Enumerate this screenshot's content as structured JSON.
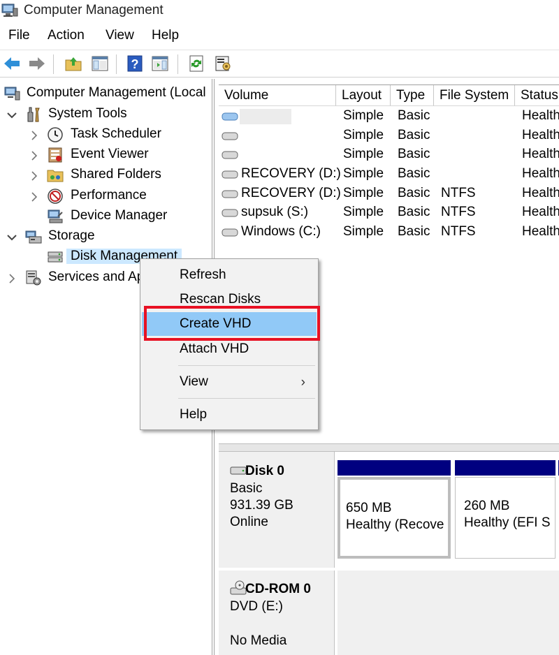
{
  "window": {
    "title": "Computer Management"
  },
  "menubar": [
    "File",
    "Action",
    "View",
    "Help"
  ],
  "tree": {
    "root": "Computer Management (Local",
    "items": [
      {
        "label": "System Tools",
        "icon": "tools-icon",
        "level": 1,
        "expanded": true
      },
      {
        "label": "Task Scheduler",
        "icon": "clock-icon",
        "level": 2,
        "expanded": false
      },
      {
        "label": "Event Viewer",
        "icon": "event-viewer-icon",
        "level": 2,
        "expanded": false
      },
      {
        "label": "Shared Folders",
        "icon": "shared-folder-icon",
        "level": 2,
        "expanded": false
      },
      {
        "label": "Performance",
        "icon": "performance-icon",
        "level": 2,
        "expanded": false
      },
      {
        "label": "Device Manager",
        "icon": "device-manager-icon",
        "level": 2
      },
      {
        "label": "Storage",
        "icon": "storage-icon",
        "level": 1,
        "expanded": true
      },
      {
        "label": "Disk Management",
        "icon": "disk-management-icon",
        "level": 2,
        "selected": true
      },
      {
        "label": "Services and Ap",
        "icon": "services-icon",
        "level": 1,
        "expanded": false
      }
    ]
  },
  "volumes": {
    "columns": [
      "Volume",
      "Layout",
      "Type",
      "File System",
      "Status"
    ],
    "rows": [
      {
        "volume": "",
        "layout": "Simple",
        "type": "Basic",
        "fs": "",
        "status": "Health"
      },
      {
        "volume": "",
        "layout": "Simple",
        "type": "Basic",
        "fs": "",
        "status": "Health"
      },
      {
        "volume": "",
        "layout": "Simple",
        "type": "Basic",
        "fs": "",
        "status": "Health"
      },
      {
        "volume": "RECOVERY (D:)",
        "layout": "Simple",
        "type": "Basic",
        "fs": "",
        "status": "Health"
      },
      {
        "volume": "RECOVERY (D:)",
        "layout": "Simple",
        "type": "Basic",
        "fs": "NTFS",
        "status": "Health"
      },
      {
        "volume": "supsuk (S:)",
        "layout": "Simple",
        "type": "Basic",
        "fs": "NTFS",
        "status": "Health"
      },
      {
        "volume": "Windows (C:)",
        "layout": "Simple",
        "type": "Basic",
        "fs": "NTFS",
        "status": "Health"
      }
    ]
  },
  "disks": {
    "disk0": {
      "name": "Disk 0",
      "type": "Basic",
      "size": "931.39 GB",
      "state": "Online",
      "partitions": [
        {
          "size": "650 MB",
          "status": "Healthy (Recove"
        },
        {
          "size": "260 MB",
          "status": "Healthy (EFI S"
        }
      ]
    },
    "cdrom0": {
      "name": "CD-ROM 0",
      "drive": "DVD (E:)",
      "state": "No Media"
    }
  },
  "context_menu": {
    "items": [
      "Refresh",
      "Rescan Disks",
      "Create VHD",
      "Attach VHD",
      "View",
      "Help"
    ],
    "highlighted": "Create VHD",
    "submenu_arrow": "›"
  },
  "colors": {
    "highlight": "#91c9f7",
    "annotation": "#e81123",
    "partition_bar": "#000080",
    "selected_tree": "#cce8ff"
  }
}
